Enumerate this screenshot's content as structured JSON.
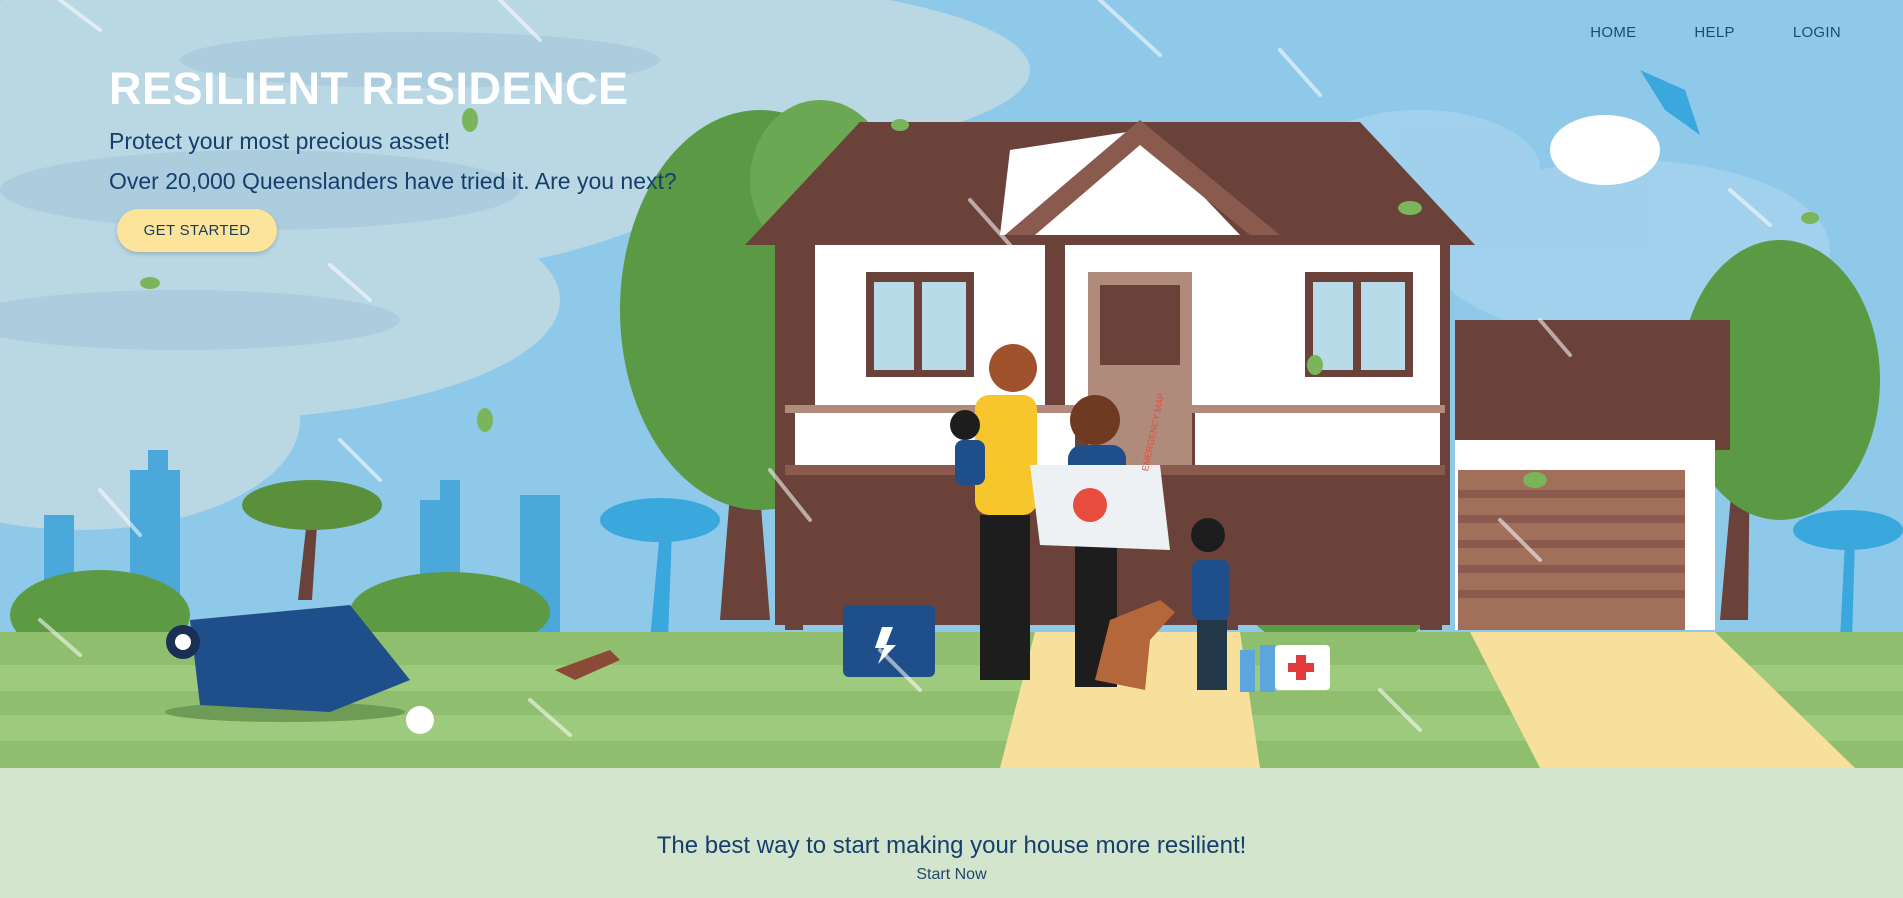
{
  "nav": {
    "home": "HOME",
    "help": "HELP",
    "login": "LOGIN"
  },
  "hero": {
    "title": "RESILIENT RESIDENCE",
    "subtitle": "Protect your most precious asset!",
    "tagline": "Over 20,000 Queenslanders have tried it. Are you next?",
    "cta_label": "GET STARTED",
    "map_label": "EMERGENCY MAP"
  },
  "footer": {
    "headline": "The best way to start making your house more resilient!",
    "link_label": "Start Now"
  },
  "colors": {
    "sky": "#8fc9ea",
    "grass": "#8fbf6e",
    "path": "#f7e09b",
    "roof": "#6b4239",
    "nav_text": "#1b4a7a",
    "cta_bg": "#fde49b",
    "footer_bg": "#d3e5cc"
  }
}
